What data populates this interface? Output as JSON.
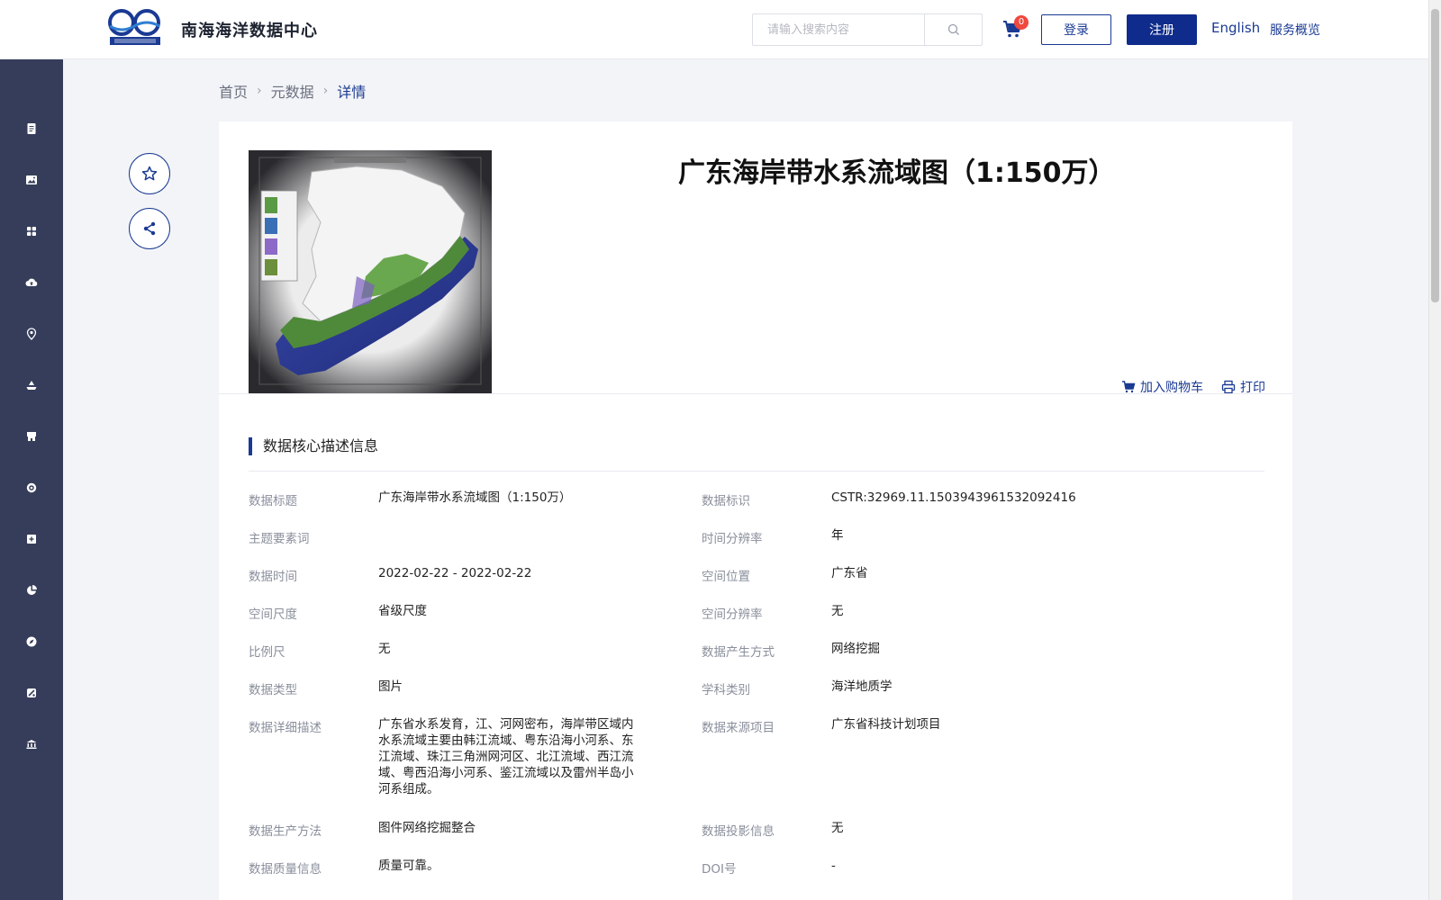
{
  "header": {
    "logo_text": "南海海洋数据中心",
    "search_placeholder": "请输入搜索内容",
    "cart_count": "0",
    "login_label": "登录",
    "register_label": "注册",
    "english_label": "English",
    "overview_label": "服务概览"
  },
  "breadcrumb": {
    "items": [
      "首页",
      "元数据",
      "详情"
    ]
  },
  "detail": {
    "title": "广东海岸带水系流域图（1:150万）",
    "add_to_cart": "加入购物车",
    "print": "打印",
    "section_title": "数据核心描述信息"
  },
  "fields": {
    "left": [
      {
        "label": "数据标题",
        "value": "广东海岸带水系流域图（1:150万）"
      },
      {
        "label": "主题要素词",
        "value": ""
      },
      {
        "label": "数据时间",
        "value": "2022-02-22 - 2022-02-22"
      },
      {
        "label": "空间尺度",
        "value": "省级尺度"
      },
      {
        "label": "比例尺",
        "value": "无"
      },
      {
        "label": "数据类型",
        "value": "图片"
      },
      {
        "label": "数据详细描述",
        "value": "广东省水系发育，江、河网密布，海岸带区域内水系流域主要由韩江流域、粤东沿海小河系、东江流域、珠江三角洲网河区、北江流域、西江流域、粤西沿海小河系、鉴江流域以及雷州半岛小河系组成。"
      },
      {
        "label": "数据生产方法",
        "value": "图件网络挖掘整合"
      },
      {
        "label": "数据质量信息",
        "value": "质量可靠。"
      }
    ],
    "right": [
      {
        "label": "数据标识",
        "value": "CSTR:32969.11.1503943961532092416"
      },
      {
        "label": "时间分辨率",
        "value": "年"
      },
      {
        "label": "空间位置",
        "value": "广东省"
      },
      {
        "label": "空间分辨率",
        "value": "无"
      },
      {
        "label": "数据产生方式",
        "value": "网络挖掘"
      },
      {
        "label": "学科类别",
        "value": "海洋地质学"
      },
      {
        "label": "数据来源项目",
        "value": "广东省科技计划项目"
      },
      {
        "label": "数据投影信息",
        "value": "无"
      },
      {
        "label": "DOI号",
        "value": "-"
      }
    ]
  },
  "sidebar": {
    "icons": [
      "document-icon",
      "image-icon",
      "grid-icon",
      "cloud-upload-icon",
      "location-pin-icon",
      "ship-icon",
      "store-icon",
      "target-icon",
      "add-box-icon",
      "pie-chart-icon",
      "compass-icon",
      "tools-icon",
      "building-icon"
    ]
  },
  "colors": {
    "primary": "#0f2c8c",
    "sidebar_bg": "#363d5b",
    "badge": "#f0483e"
  }
}
